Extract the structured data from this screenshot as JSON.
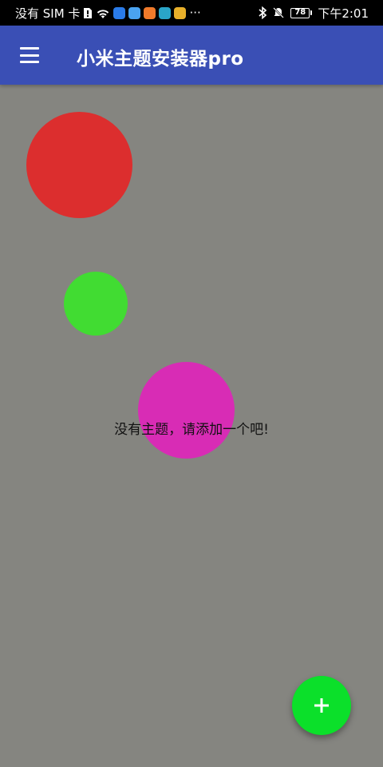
{
  "status_bar": {
    "carrier": "没有 SIM 卡",
    "battery_level": "78",
    "time": "下午2:01",
    "more": "···",
    "app_badge_colors": [
      "#2a7be8",
      "#4aa3f0",
      "#f07a2a",
      "#2aa5c8",
      "#e8b02a"
    ]
  },
  "app_bar": {
    "title": "小米主题安装器pro",
    "background": "#3a4fb5",
    "menu_icon": "hamburger-menu-icon"
  },
  "main": {
    "background": "#858580",
    "empty_message": "没有主题，请添加一个吧!",
    "circle_colors": [
      "#dc2e2e",
      "#41dc32",
      "#d82cb5"
    ]
  },
  "fab": {
    "icon": "plus-icon",
    "color": "#0be02a"
  }
}
